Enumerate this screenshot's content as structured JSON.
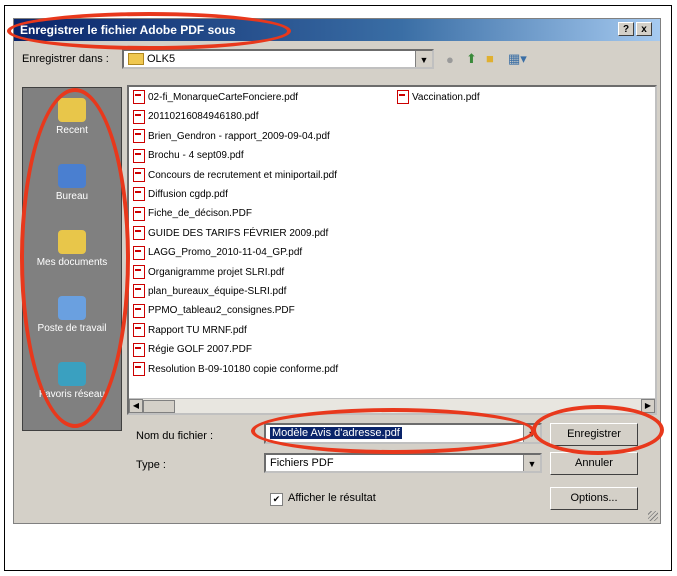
{
  "dialog": {
    "title": "Enregistrer le fichier Adobe PDF sous",
    "help_button": "?",
    "close_button": "x"
  },
  "location": {
    "label": "Enregistrer dans :",
    "value": "OLK5"
  },
  "places": [
    {
      "label": "Recent",
      "icon": "recent-folder-icon",
      "color": "#e8c64a"
    },
    {
      "label": "Bureau",
      "icon": "desktop-icon",
      "color": "#4a7fd0"
    },
    {
      "label": "Mes documents",
      "icon": "my-documents-icon",
      "color": "#e8c64a"
    },
    {
      "label": "Poste de travail",
      "icon": "my-computer-icon",
      "color": "#6aa0e0"
    },
    {
      "label": "Favoris réseau",
      "icon": "network-places-icon",
      "color": "#3aa0c0"
    }
  ],
  "files_col1": [
    "02-fi_MonarqueCarteFonciere.pdf",
    "20110216084946180.pdf",
    "Brien_Gendron - rapport_2009-09-04.pdf",
    "Brochu - 4 sept09.pdf",
    "Concours de recrutement et miniportail.pdf",
    "Diffusion cgdp.pdf",
    "Fiche_de_décison.PDF",
    "GUIDE DES TARIFS FÉVRIER 2009.pdf",
    "LAGG_Promo_2010-11-04_GP.pdf",
    "Organigramme projet SLRI.pdf",
    "plan_bureaux_équipe-SLRI.pdf",
    "PPMO_tableau2_consignes.PDF",
    "Rapport TU MRNF.pdf",
    "Régie GOLF 2007.PDF",
    "Resolution B-09-10180 copie conforme.pdf"
  ],
  "files_col2": [
    "Vaccination.pdf"
  ],
  "filename": {
    "label": "Nom du fichier :",
    "value": "Modèle Avis d'adresse.pdf"
  },
  "filetype": {
    "label": "Type :",
    "value": "Fichiers PDF"
  },
  "buttons": {
    "save": "Enregistrer",
    "cancel": "Annuler",
    "options": "Options..."
  },
  "show_result": {
    "label": "Afficher le résultat",
    "checked": true
  },
  "annotation_color": "#e8381c"
}
